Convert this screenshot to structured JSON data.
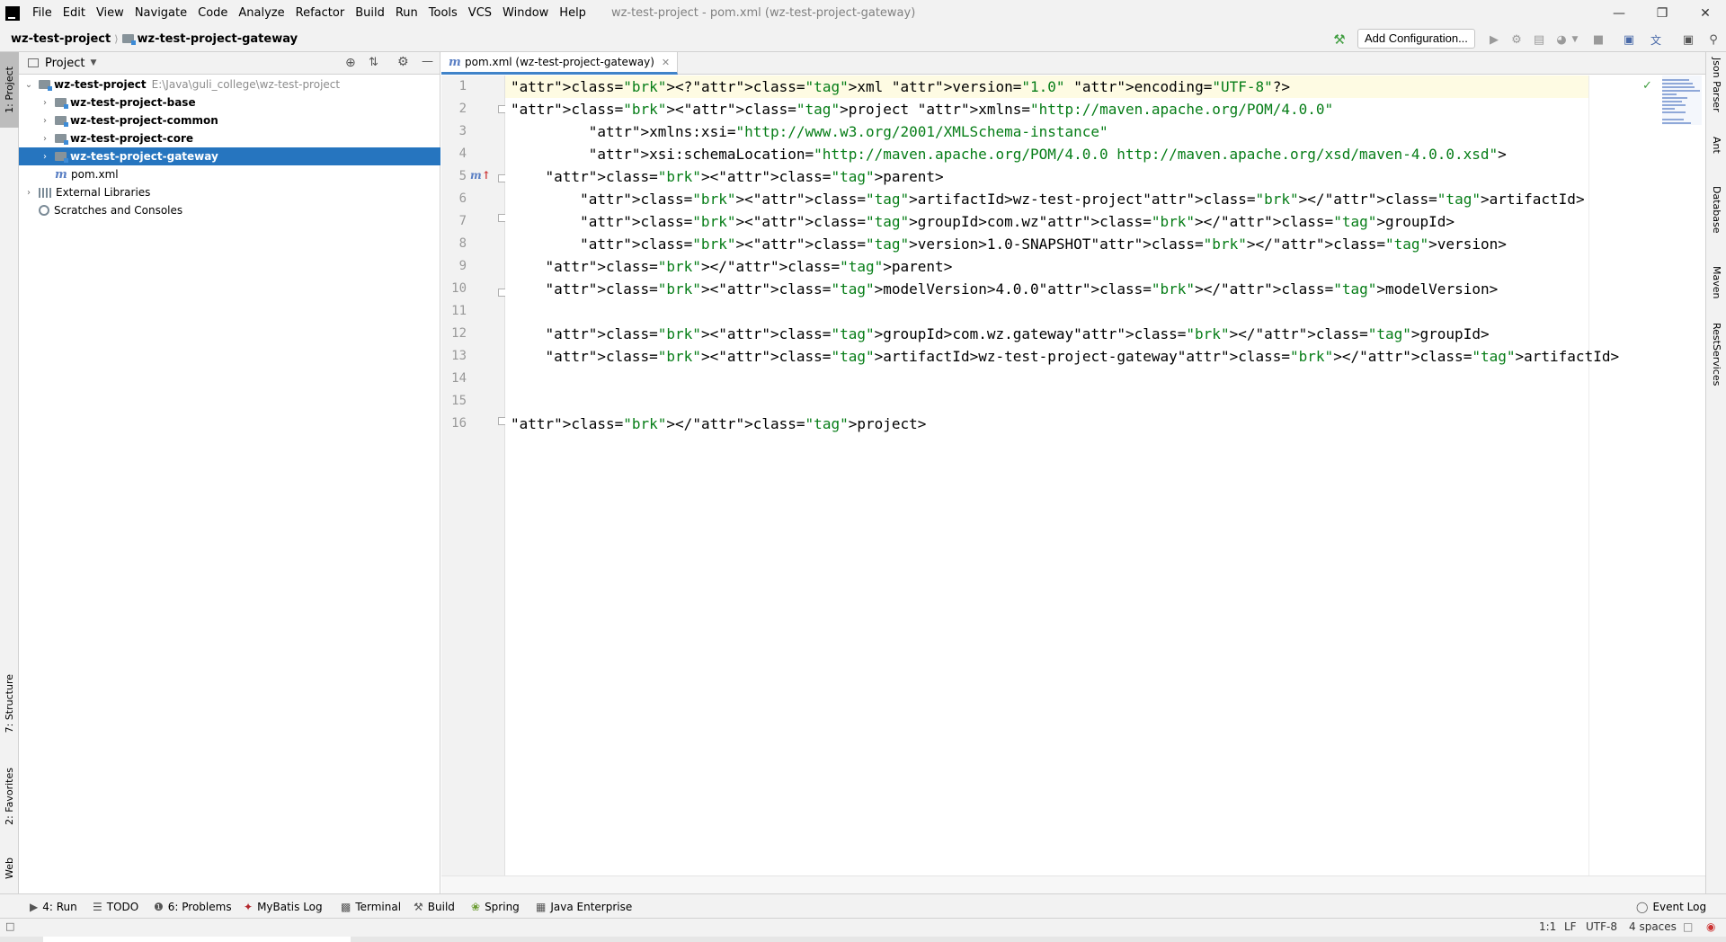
{
  "menu": {
    "items": [
      "File",
      "Edit",
      "View",
      "Navigate",
      "Code",
      "Analyze",
      "Refactor",
      "Build",
      "Run",
      "Tools",
      "VCS",
      "Window",
      "Help"
    ],
    "window_title": "wz-test-project - pom.xml (wz-test-project-gateway)"
  },
  "breadcrumb": {
    "project": "wz-test-project",
    "module": "wz-test-project-gateway"
  },
  "toolbar": {
    "add_configuration": "Add Configuration..."
  },
  "left_strip": {
    "project": "1: Project",
    "structure": "7: Structure",
    "favorites": "2: Favorites",
    "web": "Web"
  },
  "project_panel": {
    "title": "Project",
    "tree": [
      {
        "label": "wz-test-project",
        "path": "E:\\Java\\guli_college\\wz-test-project"
      },
      {
        "label": "wz-test-project-base"
      },
      {
        "label": "wz-test-project-common"
      },
      {
        "label": "wz-test-project-core"
      },
      {
        "label": "wz-test-project-gateway"
      },
      {
        "label": "pom.xml"
      },
      {
        "label": "External Libraries"
      },
      {
        "label": "Scratches and Consoles"
      }
    ]
  },
  "editor": {
    "tab": "pom.xml (wz-test-project-gateway)",
    "line_numbers": [
      "1",
      "2",
      "3",
      "4",
      "5",
      "6",
      "7",
      "8",
      "9",
      "10",
      "11",
      "12",
      "13",
      "14",
      "15",
      "16"
    ],
    "lines": [
      "<?xml version=\"1.0\" encoding=\"UTF-8\"?>",
      "<project xmlns=\"http://maven.apache.org/POM/4.0.0\"",
      "         xmlns:xsi=\"http://www.w3.org/2001/XMLSchema-instance\"",
      "         xsi:schemaLocation=\"http://maven.apache.org/POM/4.0.0 http://maven.apache.org/xsd/maven-4.0.0.xsd\">",
      "    <parent>",
      "        <artifactId>wz-test-project</artifactId>",
      "        <groupId>com.wz</groupId>",
      "        <version>1.0-SNAPSHOT</version>",
      "    </parent>",
      "    <modelVersion>4.0.0</modelVersion>",
      "",
      "    <groupId>com.wz.gateway</groupId>",
      "    <artifactId>wz-test-project-gateway</artifactId>",
      "",
      "",
      "</project>"
    ]
  },
  "right_strip": {
    "json_parser": "Json Parser",
    "ant": "Ant",
    "database": "Database",
    "maven": "Maven",
    "rest_services": "RestServices"
  },
  "bottom_tools": {
    "run": "4: Run",
    "todo": "TODO",
    "problems": "6: Problems",
    "mybatis_log": "MyBatis Log",
    "terminal": "Terminal",
    "build": "Build",
    "spring": "Spring",
    "java_enterprise": "Java Enterprise",
    "event_log": "Event Log"
  },
  "status": {
    "position": "1:1",
    "line_sep": "LF",
    "encoding": "UTF-8",
    "indent": "4 spaces"
  }
}
